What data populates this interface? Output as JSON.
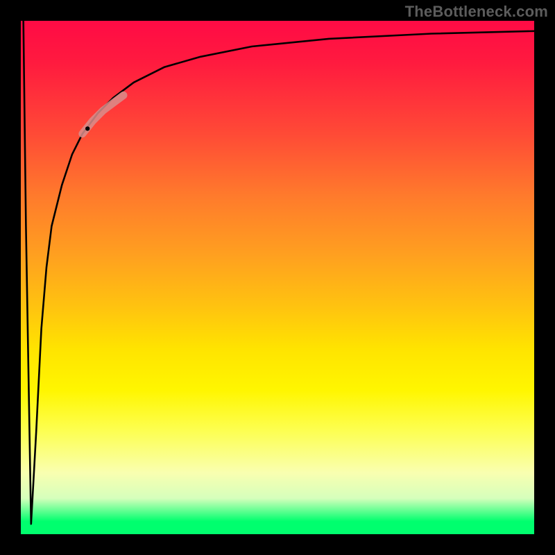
{
  "watermark": {
    "text": "TheBottleneck.com"
  },
  "chart_data": {
    "type": "line",
    "title": "",
    "xlabel": "",
    "ylabel": "",
    "xlim": [
      0,
      100
    ],
    "ylim": [
      0,
      100
    ],
    "background_gradient": {
      "orientation": "vertical",
      "stops": [
        {
          "pos": 0.0,
          "color": "#ff0b45"
        },
        {
          "pos": 0.35,
          "color": "#ff7a2c"
        },
        {
          "pos": 0.65,
          "color": "#ffe400"
        },
        {
          "pos": 0.9,
          "color": "#f9ffb0"
        },
        {
          "pos": 0.975,
          "color": "#00ff6e"
        },
        {
          "pos": 1.0,
          "color": "#00ff6e"
        }
      ]
    },
    "series": [
      {
        "name": "bottleneck-curve",
        "color": "#000000",
        "x": [
          0.5,
          1,
          2,
          3,
          4,
          5,
          6,
          8,
          10,
          12,
          15,
          18,
          22,
          28,
          35,
          45,
          60,
          80,
          100
        ],
        "y": [
          100,
          60,
          2,
          20,
          40,
          52,
          60,
          68,
          74,
          78,
          82,
          85,
          88,
          91,
          93,
          95,
          96.5,
          97.5,
          98
        ]
      }
    ],
    "highlight": {
      "name": "emphasis-segment",
      "color": "#d88e8c",
      "x": [
        12,
        14,
        16,
        18,
        20
      ],
      "y": [
        78,
        80.5,
        82.5,
        84,
        85.5
      ]
    },
    "marker": {
      "name": "point-marker",
      "x": 13,
      "y": 79,
      "color": "#000000"
    }
  }
}
